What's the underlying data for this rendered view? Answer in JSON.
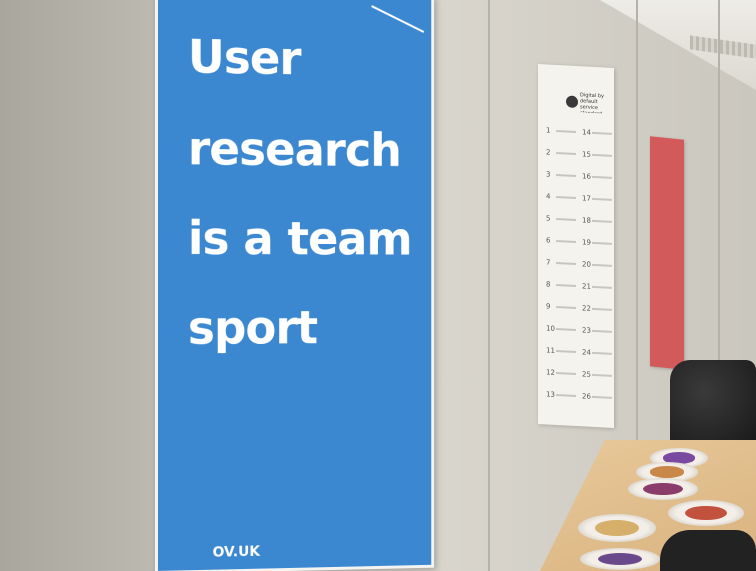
{
  "poster_main": {
    "lines": [
      "User",
      "research",
      "is a team",
      "sport"
    ],
    "footer": "OV.UK",
    "color": "#3b88d0"
  },
  "poster_numbered": {
    "title": "Digital by default service standard",
    "numbers": [
      "1",
      "2",
      "3",
      "4",
      "5",
      "6",
      "7",
      "8",
      "9",
      "10",
      "11",
      "12",
      "13",
      "14",
      "15",
      "16",
      "17",
      "18",
      "19",
      "20",
      "21",
      "22",
      "23",
      "24",
      "25",
      "26"
    ]
  },
  "poster_red": {
    "color": "#d35a5a"
  }
}
